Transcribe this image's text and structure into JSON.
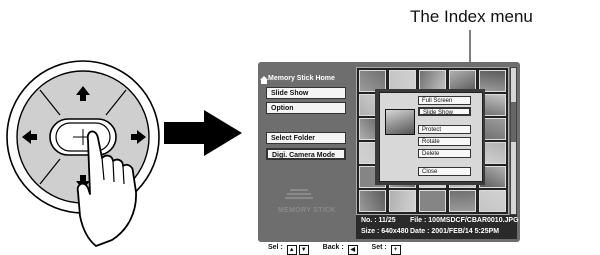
{
  "caption": "The Index menu",
  "screen": {
    "home_label": "Memory Stick Home",
    "buttons": [
      "Slide Show",
      "Option",
      "Select Folder",
      "Digi. Camera Mode"
    ],
    "popup_menu": [
      "Full Screen",
      "Slide Show",
      "Protect",
      "Rotate",
      "Delete",
      "Close"
    ],
    "info": {
      "number": "No. : 11/25",
      "file": "File : 100MSDCF/CBAR0010.JPG",
      "size": "Size : 640x480",
      "date": "Date : 2001/FEB/14 5:25PM"
    },
    "logo_text": "MEMORY STICK"
  },
  "legend": {
    "sel": "Sel :",
    "back": "Back :",
    "set": "Set :"
  },
  "colors": {
    "screen_bg": "#6e6e6e",
    "remote_gray": "#cfcfcf",
    "arrow": "#000000"
  }
}
